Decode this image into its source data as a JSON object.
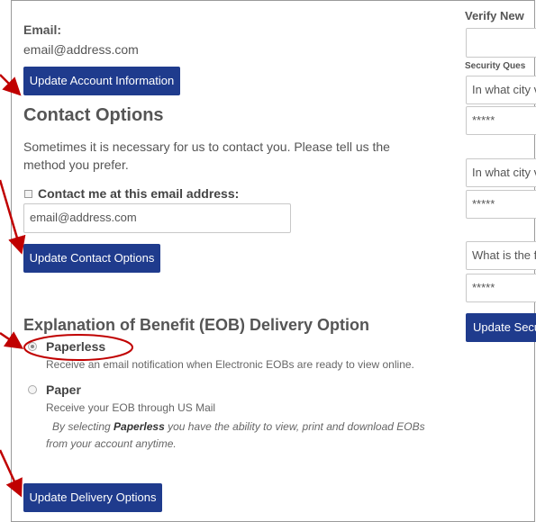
{
  "left": {
    "email_label": "Email:",
    "email_value": "email@address.com",
    "update_account_btn": "Update Account Information",
    "contact_heading": "Contact Options",
    "contact_desc": "Sometimes it is necessary for us to contact you. Please tell us the method you prefer.",
    "contact_check_label": "Contact me at this email address:",
    "contact_email_input": "email@address.com",
    "update_contact_btn": "Update Contact Options",
    "eob_heading": "Explanation of Benefit (EOB) Delivery Option",
    "paperless_label": "Paperless",
    "paperless_desc": "Receive an email notification when Electronic EOBs are ready to view online.",
    "paper_label": "Paper",
    "paper_desc": "Receive your EOB through US Mail",
    "note_prefix": "By selecting ",
    "note_bold": "Paperless",
    "note_suffix": " you have the ability to view, print and download EOBs",
    "note_line2": "from your account anytime.",
    "update_delivery_btn": "Update Delivery Options"
  },
  "right": {
    "verify_label": "Verify New",
    "security_label": "Security Ques",
    "q1": "In what city v",
    "a1": "*****",
    "q2": "In what city v",
    "a2": "*****",
    "q3": "What is the f",
    "a3": "*****",
    "update_security_btn": "Update Secu"
  },
  "colors": {
    "button": "#1f3b8d",
    "annotation": "#c00000"
  }
}
